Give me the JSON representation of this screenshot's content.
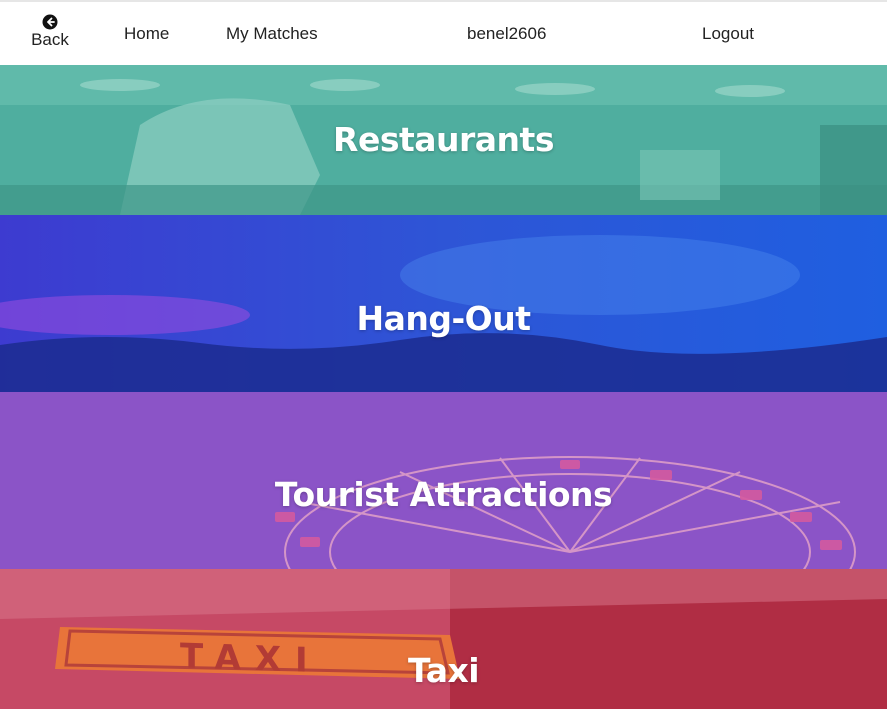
{
  "nav": {
    "back_label": "Back",
    "home_label": "Home",
    "matches_label": "My Matches",
    "username": "benel2606",
    "logout_label": "Logout"
  },
  "categories": [
    {
      "label": "Restaurants",
      "overlay_color": "#4aa99a"
    },
    {
      "label": "Hang-Out",
      "overlay_color": "#2f46c4"
    },
    {
      "label": "Tourist Attractions",
      "overlay_color": "#8a52c6"
    },
    {
      "label": "Taxi",
      "overlay_color": "#c94a66"
    }
  ],
  "icons": {
    "back": "arrow-circle-left-icon"
  }
}
